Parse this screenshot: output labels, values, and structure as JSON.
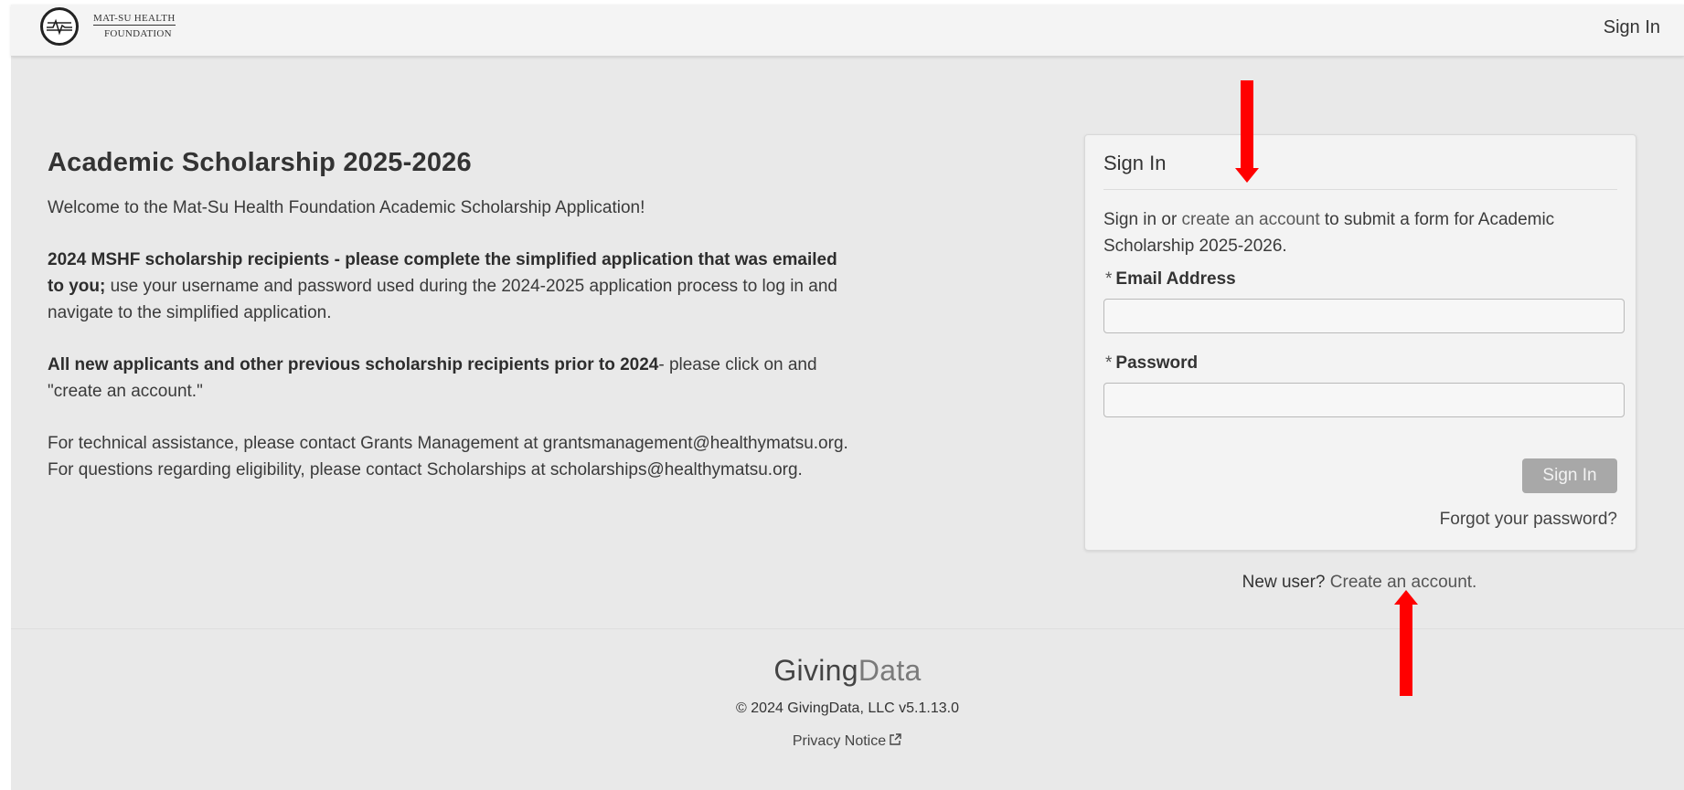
{
  "header": {
    "logo_line1": "MAT-SU HEALTH",
    "logo_line2": "FOUNDATION",
    "sign_in": "Sign In"
  },
  "intro": {
    "title": "Academic Scholarship 2025-2026",
    "welcome": "Welcome to the Mat-Su Health Foundation Academic Scholarship Application!",
    "p2_bold": "2024 MSHF scholarship recipients - please complete the simplified application that was emailed to you;",
    "p2_rest": " use your username and password used during the 2024-2025 application process to log in and navigate to the simplified application.",
    "p3_bold": "All new applicants and other previous scholarship recipients prior to 2024",
    "p3_rest": "- please click on and \"create an account.\"",
    "p4": "For technical assistance, please contact Grants Management at grantsmanagement@healthymatsu.org. For questions regarding eligibility, please contact Scholarships at scholarships@healthymatsu.org."
  },
  "signin_card": {
    "title": "Sign In",
    "text_pre": "Sign in or ",
    "text_link": "create an account",
    "text_post": " to submit a form for Academic Scholarship 2025-2026.",
    "email_label": "Email Address",
    "password_label": "Password",
    "required_mark": "*",
    "email_value": "",
    "password_value": "",
    "button": "Sign In",
    "forgot": "Forgot your password?"
  },
  "new_user": {
    "prefix": "New user? ",
    "link": "Create an account."
  },
  "footer": {
    "logo_giving": "Giving",
    "logo_data": "Data",
    "copyright": "© 2024 GivingData, LLC v5.1.13.0",
    "privacy": "Privacy Notice",
    "privacy_icon": "external-link-icon"
  },
  "colors": {
    "annotation_arrow": "#ff0000",
    "background": "#e9e9e9"
  }
}
